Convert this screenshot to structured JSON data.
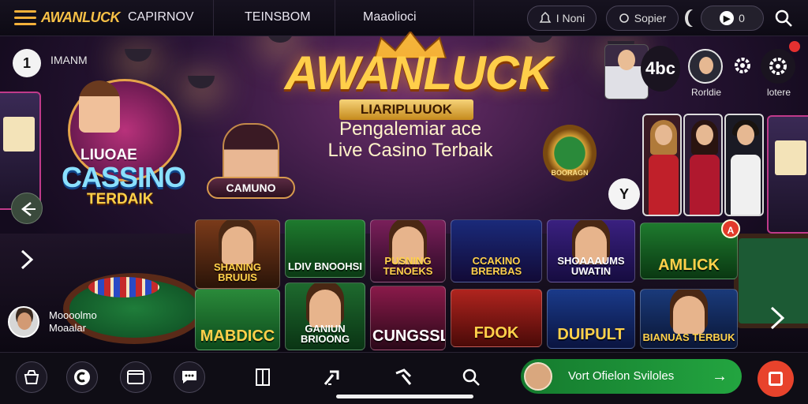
{
  "topbar": {
    "brand": "AWANLUCK",
    "nav": [
      "CAPIRNOV",
      "TEINSBOM",
      "Maaolioci"
    ],
    "pill_notifications": "I Noni",
    "pill_register": "Sopier",
    "pill_toggle": "0"
  },
  "hero": {
    "title": "AWANLUCK",
    "ribbon": "LIARIPLUUOK",
    "subtitle_line1": "Pengalemiar ace",
    "subtitle_line2": "Live Casino Terbaik",
    "coin_label": "BOORAGN",
    "dice": "Y"
  },
  "left": {
    "chip": "1",
    "label": "IMANM",
    "badge_top": "LIUOAE",
    "badge_main": "CASSINO",
    "badge_bottom": "TERDAIK",
    "camuno": "CAMUNO",
    "user_line1": "Moooolmo",
    "user_line2": "Moaalar"
  },
  "topright": {
    "counter": "4bc",
    "label_avatar": "Rorldie",
    "label_settings": "lotere"
  },
  "tiles": [
    {
      "label": "SHANING BRUUIS",
      "color_top": "#7a3a1a",
      "color_bottom": "#2a1408",
      "text_color": "#ffd14a"
    },
    {
      "label": "LDIV BNOOHSI",
      "color_top": "#1e7a2e",
      "color_bottom": "#0b3a14",
      "text_color": "#ffffff"
    },
    {
      "label": "PUSNING TENOEKS",
      "color_top": "#7a1f5a",
      "color_bottom": "#2a0a24",
      "text_color": "#ffd14a"
    },
    {
      "label": "CCAKINO BRERBAS",
      "color_top": "#1a2a7a",
      "color_bottom": "#120a36",
      "text_color": "#ffd14a"
    },
    {
      "label": "SHOAAAUMS UWATIN",
      "color_top": "#3a2080",
      "color_bottom": "#160c40",
      "text_color": "#ffffff"
    },
    {
      "label": "AMLICK",
      "color_top": "#1e7a2e",
      "color_bottom": "#0a3812",
      "text_color": "#ffd14a"
    },
    {
      "label": "MABDICC",
      "color_top": "#2a8a3a",
      "color_bottom": "#0d4a1c",
      "text_color": "#ffd14a"
    },
    {
      "label": "GANIUN BRIOONG",
      "color_top": "#1e6a2e",
      "color_bottom": "#0a3414",
      "text_color": "#ffffff"
    },
    {
      "label": "CUNGSSLIS",
      "color_top": "#8a1a4a",
      "color_bottom": "#2a0818",
      "text_color": "#ffffff"
    },
    {
      "label": "FDOK",
      "color_top": "#b0241e",
      "color_bottom": "#4a0a08",
      "text_color": "#ffd14a"
    },
    {
      "label": "DUIPULT",
      "color_top": "#1a3a8a",
      "color_bottom": "#0a1440",
      "text_color": "#ffd14a"
    },
    {
      "label": "BIANUAS TERBUK",
      "color_top": "#1a3a7a",
      "color_bottom": "#0a1636",
      "text_color": "#ffd14a"
    }
  ],
  "red_badge": "A",
  "bottombar": {
    "cta_text": "Vort Ofielon Sviloles",
    "cta_arrow": "→"
  },
  "colors": {
    "brand": "#f6c046",
    "cta": "#1f9a3a",
    "stop": "#e8432c"
  }
}
